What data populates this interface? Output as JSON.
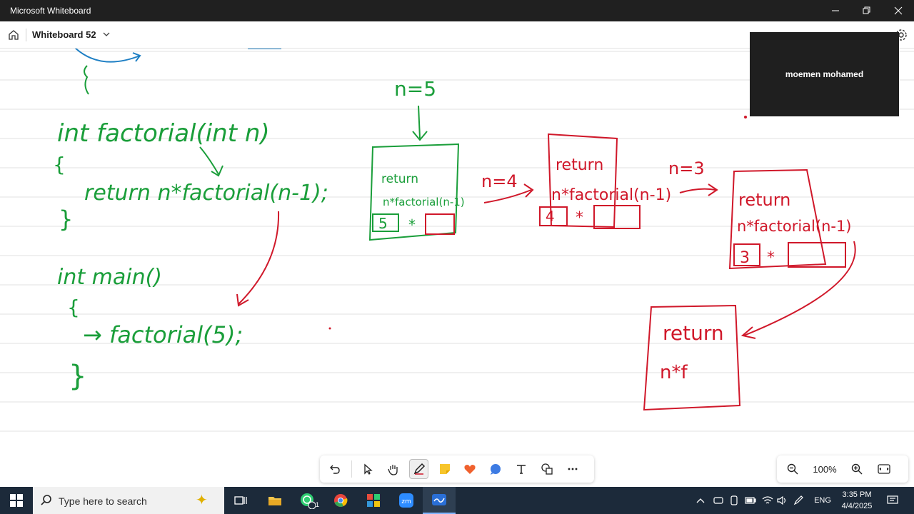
{
  "window": {
    "title": "Microsoft Whiteboard"
  },
  "appbar": {
    "board_name": "Whiteboard 52"
  },
  "participant": {
    "name": "moemen mohamed"
  },
  "whiteboard": {
    "ink_text": {
      "n_eq_5": "n=5",
      "n_eq_4": "n=4",
      "n_eq_3": "n=3",
      "code_fn_signature": "int factorial(int n)",
      "code_open_brace": "{",
      "code_return": "return n*factorial(n-1);",
      "code_close_brace": "}",
      "code_main": "int main()",
      "code_main_open": "{",
      "code_main_call": "→ factorial(5);",
      "code_main_close": "}",
      "box1_return": "return",
      "box1_expr": "n*factorial(n-1)",
      "box1_value": "5",
      "box1_op": "*",
      "box2_return": "return",
      "box2_expr": "n*factorial(n-1)",
      "box2_value": "4",
      "box2_op": "*",
      "box3_return": "return",
      "box3_expr": "n*factorial(n-1)",
      "box3_value": "3",
      "box3_op": "*",
      "box4_return": "return",
      "box4_expr": "n*f"
    },
    "colors": {
      "green_ink": "#1a9e3a",
      "red_ink": "#d0182a",
      "blue_ink": "#1e7fc4"
    }
  },
  "toolbar": {
    "tools": [
      "undo-icon",
      "select-icon",
      "pan-icon",
      "pen-icon",
      "sticky-note-icon",
      "reactions-icon",
      "comment-icon",
      "text-icon",
      "shapes-icon",
      "more-icon"
    ],
    "active_tool": "pen-icon"
  },
  "zoom": {
    "value": "100%"
  },
  "taskbar": {
    "search_placeholder": "Type here to search",
    "apps": [
      "task-view-icon",
      "file-explorer-icon",
      "whatsapp-icon",
      "chrome-icon",
      "office-icon",
      "zoom-icon",
      "whiteboard-icon"
    ],
    "whatsapp_badge": "1",
    "language": "ENG",
    "time": "3:35 PM",
    "date": "4/4/2025"
  }
}
